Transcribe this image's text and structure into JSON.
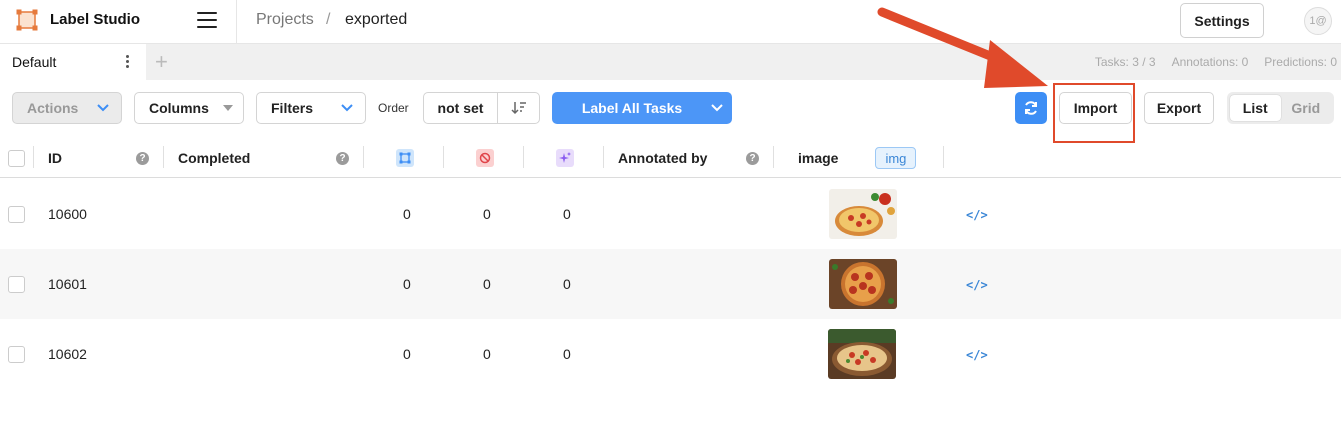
{
  "app": {
    "name": "Label Studio"
  },
  "breadcrumb": {
    "projects": "Projects",
    "separator": "/",
    "current": "exported"
  },
  "header": {
    "settings_label": "Settings",
    "avatar_text": "1@"
  },
  "tabs": {
    "default_label": "Default",
    "add_symbol": "+"
  },
  "stats": {
    "tasks": "Tasks: 3 / 3",
    "annotations": "Annotations: 0",
    "predictions": "Predictions: 0"
  },
  "toolbar": {
    "actions_label": "Actions",
    "columns_label": "Columns",
    "filters_label": "Filters",
    "order_label": "Order",
    "order_value": "not set",
    "label_all_label": "Label All Tasks",
    "import_label": "Import",
    "export_label": "Export",
    "view_list_label": "List",
    "view_grid_label": "Grid"
  },
  "table": {
    "headers": {
      "id": "ID",
      "completed": "Completed",
      "annotated_by": "Annotated by",
      "image": "image",
      "image_tag": "img"
    },
    "rows": [
      {
        "id": "10600",
        "total_annotations": "0",
        "cancelled": "0",
        "predictions": "0",
        "data_icon": "</>"
      },
      {
        "id": "10601",
        "total_annotations": "0",
        "cancelled": "0",
        "predictions": "0",
        "data_icon": "</>"
      },
      {
        "id": "10602",
        "total_annotations": "0",
        "cancelled": "0",
        "predictions": "0",
        "data_icon": "</>"
      }
    ]
  },
  "colors": {
    "accent": "#4c96f7",
    "highlight": "#e04a2b",
    "tag": "#3a86d6"
  }
}
